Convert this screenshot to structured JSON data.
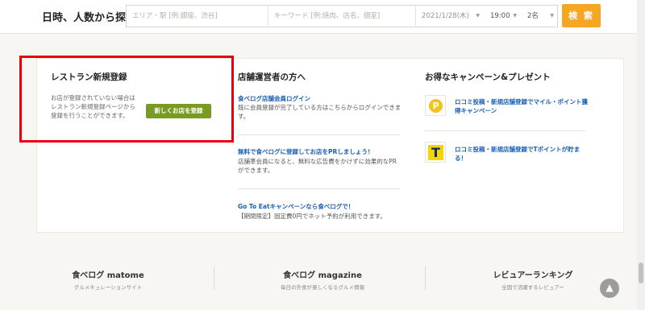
{
  "search": {
    "title": "日時、人数から探す",
    "area_placeholder": "エリア・駅 [例:銀座、渋谷]",
    "keyword_placeholder": "キーワード [例:焼肉、店名、個室]",
    "date": "2021/1/28(木)",
    "time": "19:00",
    "people": "2名",
    "button_label": "検 索"
  },
  "restaurant_register": {
    "heading": "レストラン新規登録",
    "body": "お店が登録されていない場合はレストラン新規登録ページから登録を行うことができます。",
    "button_label": "新しくお店を登録"
  },
  "owners": {
    "heading": "店舗運営者の方へ",
    "items": [
      {
        "link": "食べログ店舗会員ログイン",
        "desc": "既に会員登録が完了している方はこちらからログインできます。"
      },
      {
        "link": "無料で食べログに登録してお店をPRしましょう！",
        "desc": "店舗準会員になると、無料な広告費をかけずに効果的なPRができます。"
      },
      {
        "link": "Go To Eatキャンペーンなら食べログで！",
        "desc": "【期間限定】固定費0円でネット予約が利用できます。"
      }
    ]
  },
  "campaigns": {
    "heading": "お得なキャンペーン&プレゼント",
    "items": [
      {
        "icon": "p-point-icon",
        "text": "ロコミ投稿・新規店舗登録でマイル・ポイント獲得キャンペーン"
      },
      {
        "icon": "t-point-icon",
        "text": "ロコミ投稿・新規店舗登録でTポイントが貯まる！"
      }
    ]
  },
  "footer": {
    "items": [
      {
        "logo": "食べログ matome",
        "sub": "グルメキュレーションサイト"
      },
      {
        "logo": "食べログ magazine",
        "sub": "毎日の外食が楽しくなるグルメ情報"
      },
      {
        "logo": "レビュアーランキング",
        "sub": "全国で活躍するレビュアー"
      }
    ]
  },
  "colors": {
    "search_button": "#f5a623",
    "register_button": "#7a9b21",
    "link": "#1a5fb4",
    "highlight": "#e60012"
  }
}
